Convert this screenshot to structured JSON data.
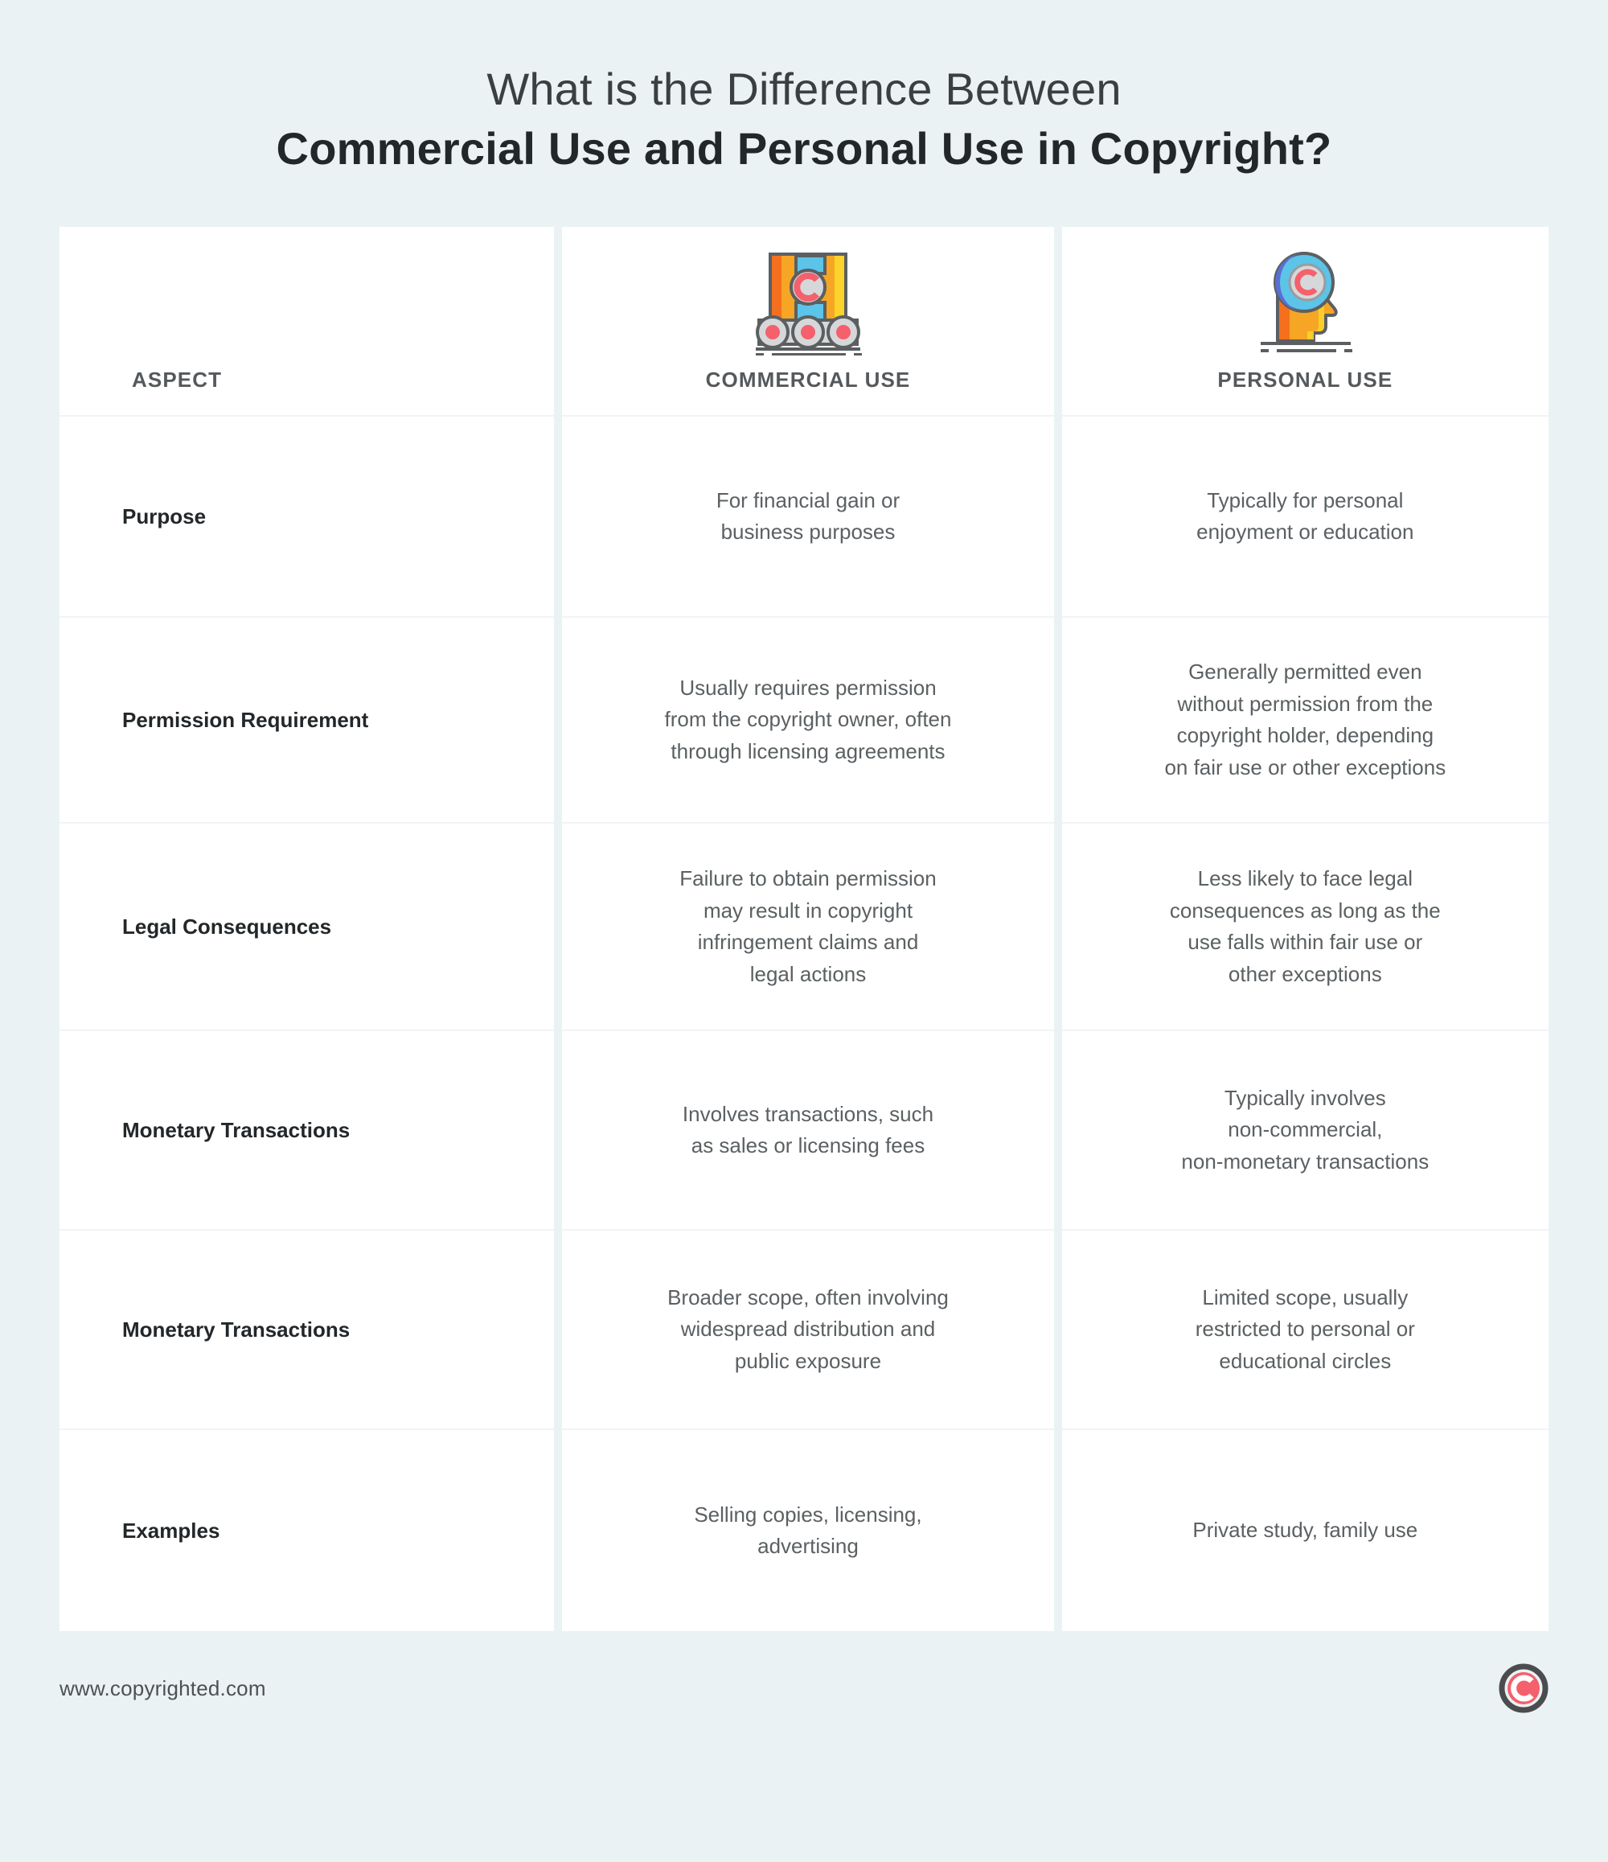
{
  "title": {
    "line1": "What is the Difference Between",
    "line2": "Commercial Use and Personal Use in Copyright?"
  },
  "table": {
    "headers": [
      {
        "label": "ASPECT",
        "icon": "none"
      },
      {
        "label": "COMMERCIAL USE",
        "icon": "conveyor-box-copyright-icon"
      },
      {
        "label": "PERSONAL USE",
        "icon": "head-copyright-icon"
      }
    ],
    "rows": [
      {
        "aspect": "Purpose",
        "commercial": "For financial gain or\nbusiness purposes",
        "personal": "Typically for personal\nenjoyment or education"
      },
      {
        "aspect": "Permission Requirement",
        "commercial": "Usually requires permission\nfrom the copyright owner, often\nthrough licensing agreements",
        "personal": "Generally permitted even\nwithout permission from the\ncopyright holder, depending\non fair use or other exceptions"
      },
      {
        "aspect": "Legal Consequences",
        "commercial": "Failure to obtain permission\nmay result in copyright\ninfringement claims and\nlegal actions",
        "personal": "Less likely to face legal\nconsequences as long as the\nuse falls within fair use or\nother exceptions"
      },
      {
        "aspect": "Monetary Transactions",
        "commercial": "Involves transactions, such\nas sales or licensing fees",
        "personal": "Typically involves\nnon-commercial,\nnon-monetary transactions"
      },
      {
        "aspect": "Monetary Transactions",
        "commercial": "Broader scope, often involving\nwidespread distribution and\npublic exposure",
        "personal": "Limited scope, usually\nrestricted to personal or\neducational circles"
      },
      {
        "aspect": "Examples",
        "commercial": "Selling copies, licensing,\nadvertising",
        "personal": "Private study, family use"
      }
    ]
  },
  "footer": {
    "url": "www.copyrighted.com",
    "logo_icon": "copyright-c-logo-icon"
  },
  "colors": {
    "page_background": "#eaf2f4",
    "card_background": "#ffffff",
    "title_regular": "#3a3f42",
    "title_bold": "#222729",
    "header_label": "#55595c",
    "aspect_text": "#23272a",
    "body_text": "#5b6063",
    "row_divider": "#f1f4f5",
    "icon_orange": "#f0952a",
    "icon_orange_dark": "#f4701f",
    "icon_yellow": "#fbd32b",
    "icon_blue": "#5bc4e8",
    "icon_blue_deep": "#5a6fd1",
    "icon_gray": "#d6d7d8",
    "icon_red": "#f4606c",
    "icon_outline": "#5c5f61",
    "logo_ring": "#4a4c4e",
    "logo_fill": "#f4606c"
  }
}
